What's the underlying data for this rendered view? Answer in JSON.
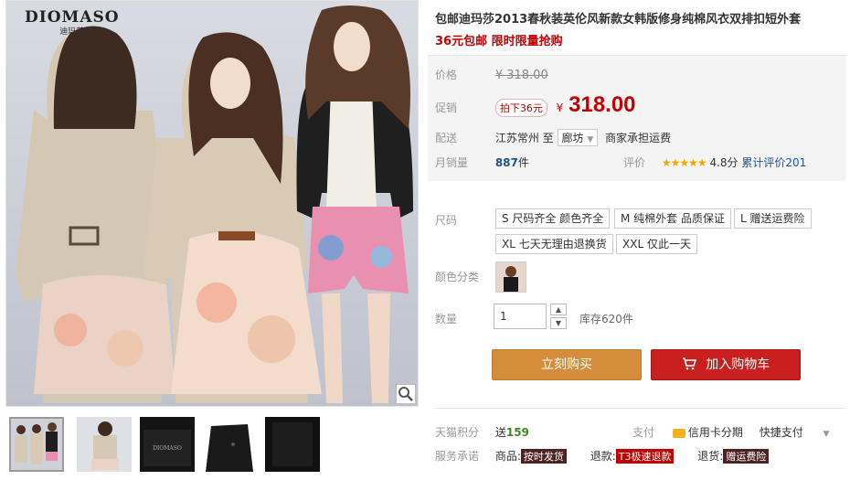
{
  "gallery": {
    "brand_name": "DIOMASO",
    "brand_sub": "迪玛莎",
    "thumbnails": [
      "thumb-1",
      "thumb-2",
      "thumb-3",
      "thumb-4",
      "thumb-5"
    ]
  },
  "product": {
    "title": "包邮迪玛莎2013春秋装英伦风新款女韩版修身纯棉风衣双排扣短外套",
    "promo": "36元包邮 限时限量抢购"
  },
  "pricing": {
    "price_label": "价格",
    "original_price": "¥ 318.00",
    "promo_label": "促销",
    "discount_tag": "拍下36元",
    "currency": "¥",
    "promo_price": "318.00",
    "ship_label": "配送",
    "ship_from": "江苏常州",
    "ship_to_word": "至",
    "ship_dest": "廊坊",
    "ship_note": "商家承担运费",
    "sales_label": "月销量",
    "sales_count": "887",
    "sales_unit": "件",
    "rating_label": "评价",
    "rating_stars": "★★★★★",
    "rating_score": "4.8分",
    "rating_total_label": "累计评价",
    "rating_total": "201"
  },
  "options": {
    "size_label": "尺码",
    "sizes": [
      "S 尺码齐全 颜色齐全",
      "M 纯棉外套 品质保证",
      "L 赠送运费险",
      "XL 七天无理由退换货",
      "XXL 仅此一天"
    ],
    "color_label": "颜色分类",
    "qty_label": "数量",
    "qty_value": "1",
    "stock_text": "库存620件"
  },
  "actions": {
    "buy_now": "立刻购买",
    "add_cart": "加入购物车"
  },
  "services": {
    "points_label": "天猫积分",
    "points_prefix": "送",
    "points_value": "159",
    "pay_label": "支付",
    "card_installment": "信用卡分期",
    "quick_pay": "快捷支付",
    "promise_label": "服务承诺",
    "goods_label": "商品:",
    "goods_badge": "按时发货",
    "refund_label": "退款:",
    "refund_badge": "T3极速退款",
    "return_label": "退货:",
    "return_badge": "赠运费险"
  },
  "colors": {
    "accent_red": "#c40000",
    "buy_orange": "#d58d3b",
    "cart_red": "#c91f1f",
    "sales_blue": "#1e5494"
  }
}
